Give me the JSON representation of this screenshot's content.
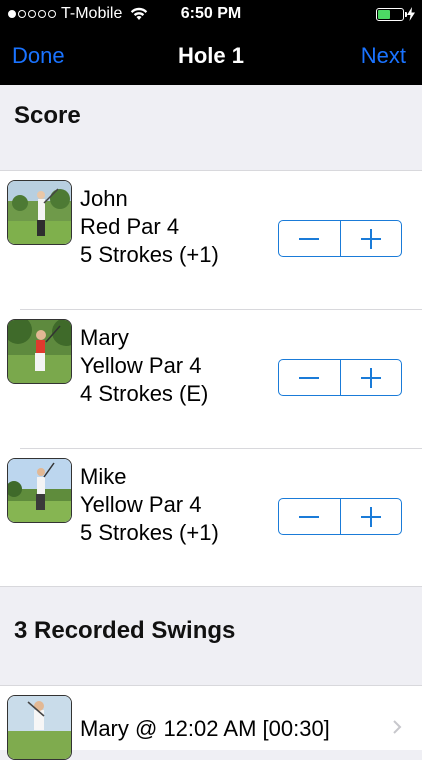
{
  "status_bar": {
    "carrier": "T-Mobile",
    "time": "6:50 PM",
    "signal_icon": "signal-dots-icon",
    "wifi_icon": "wifi-icon",
    "battery_icon": "battery-icon",
    "battery_level": 0.5,
    "battery_color": "#4cd964"
  },
  "nav": {
    "done_label": "Done",
    "title": "Hole 1",
    "next_label": "Next",
    "accent_color": "#1a73ff"
  },
  "score_section": {
    "title": "Score",
    "players": [
      {
        "name": "John",
        "tee": "Red Par 4",
        "strokes": "5 Strokes (+1)",
        "decrement_icon": "minus-icon",
        "increment_icon": "plus-icon"
      },
      {
        "name": "Mary",
        "tee": "Yellow Par 4",
        "strokes": "4 Strokes (E)",
        "decrement_icon": "minus-icon",
        "increment_icon": "plus-icon"
      },
      {
        "name": "Mike",
        "tee": "Yellow Par 4",
        "strokes": "5 Strokes (+1)",
        "decrement_icon": "minus-icon",
        "increment_icon": "plus-icon"
      }
    ]
  },
  "swings_section": {
    "title": "3 Recorded Swings",
    "items": [
      {
        "label": "Mary @ 12:02 AM [00:30]",
        "chevron_icon": "chevron-right-icon"
      }
    ]
  }
}
